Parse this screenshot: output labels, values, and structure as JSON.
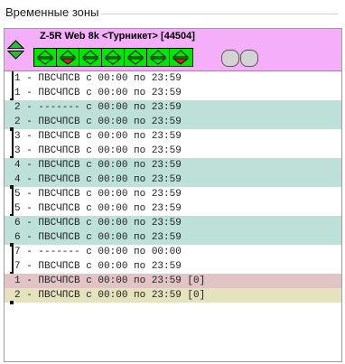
{
  "group": {
    "title": "Временные зоны"
  },
  "device": {
    "title": "Z-5R Web 8k <Турникет> [44504]",
    "zones": [
      {
        "state": "up"
      },
      {
        "state": "down"
      },
      {
        "state": "up"
      },
      {
        "state": "up"
      },
      {
        "state": "up"
      },
      {
        "state": "up"
      },
      {
        "state": "down"
      }
    ],
    "colors": {
      "header_bg": "#f5aefa",
      "zone_bg": "#00e800",
      "arrow_down": "#e11a1a"
    }
  },
  "rows": [
    {
      "text": "1 - ПВСЧПСВ с 00:00 по 23:59",
      "style": "white"
    },
    {
      "text": "1 - ПВСЧПСВ с 00:00 по 23:59",
      "style": "white"
    },
    {
      "text": "2 - ------- с 00:00 по 23:59",
      "style": "alt"
    },
    {
      "text": "2 - ПВСЧПСВ с 00:00 по 23:59",
      "style": "alt"
    },
    {
      "text": "3 - ПВСЧПСВ с 00:00 по 23:59",
      "style": "white"
    },
    {
      "text": "3 - ПВСЧПСВ с 00:00 по 23:59",
      "style": "white"
    },
    {
      "text": "4 - ПВСЧПСВ с 00:00 по 23:59",
      "style": "alt"
    },
    {
      "text": "4 - ПВСЧПСВ с 00:00 по 23:59",
      "style": "alt"
    },
    {
      "text": "5 - ПВСЧПСВ с 00:00 по 23:59",
      "style": "white"
    },
    {
      "text": "5 - ПВСЧПСВ с 00:00 по 23:59",
      "style": "white"
    },
    {
      "text": "6 - ПВСЧПСВ с 00:00 по 23:59",
      "style": "alt"
    },
    {
      "text": "6 - ПВСЧПСВ с 00:00 по 23:59",
      "style": "alt"
    },
    {
      "text": "7 - ------- с 00:00 по 00:00",
      "style": "white"
    },
    {
      "text": "7 - ПВСЧПСВ с 00:00 по 23:59",
      "style": "white"
    },
    {
      "text": "1 - ПВСЧПСВ с 00:00 по 23:59 [0]",
      "style": "last-a"
    },
    {
      "text": "2 - ПВСЧПСВ с 00:00 по 23:59 [0]",
      "style": "last-b"
    }
  ]
}
